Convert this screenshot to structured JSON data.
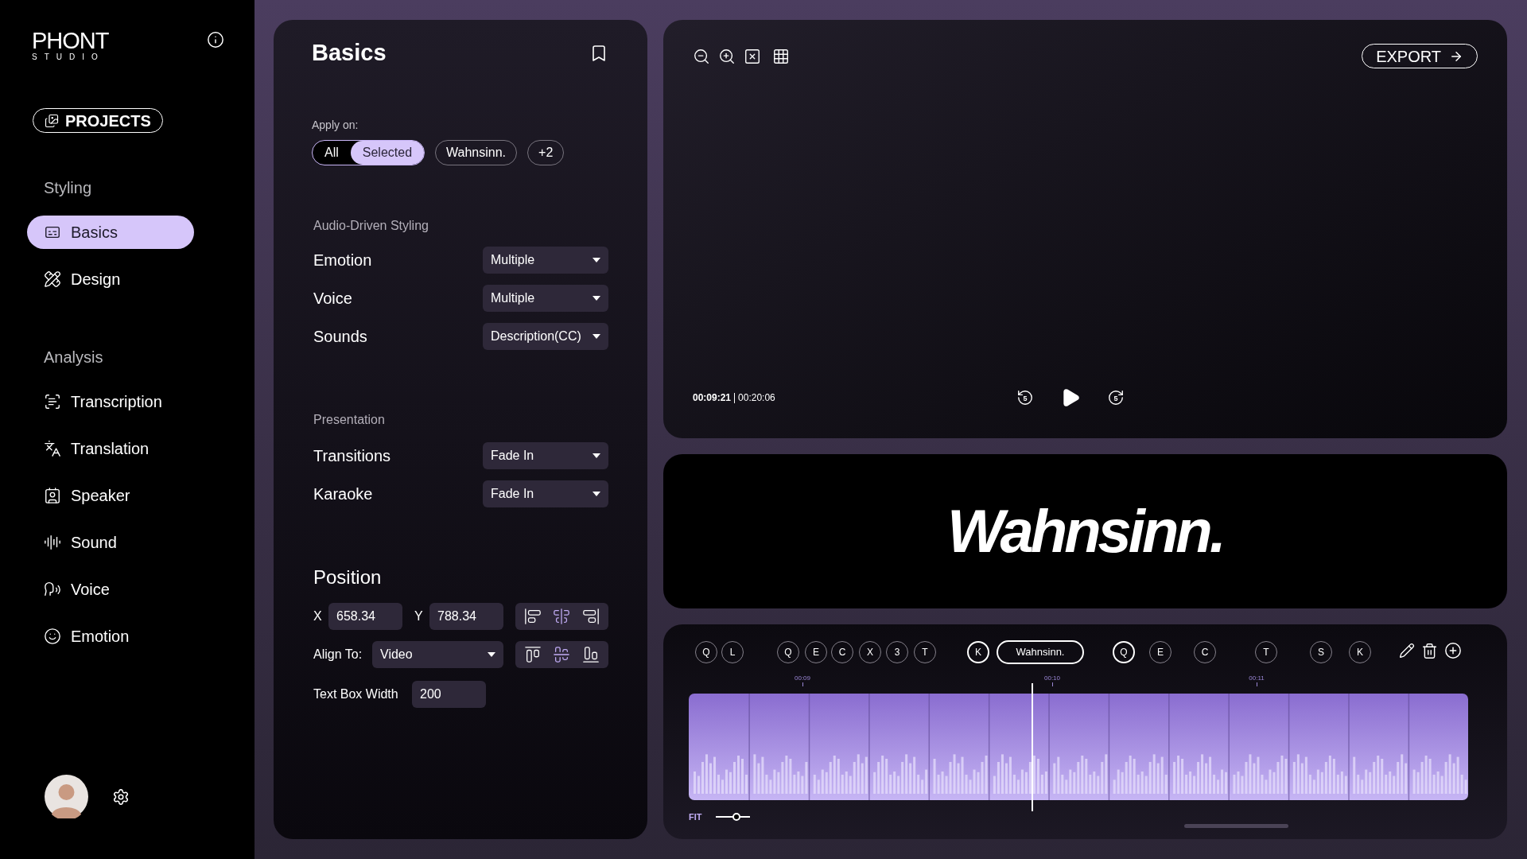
{
  "sidebar": {
    "logo": {
      "name": "PHONT",
      "sub": "STUDIO"
    },
    "projects_button": "PROJECTS",
    "sections": [
      {
        "title": "Styling",
        "items": [
          {
            "label": "Basics",
            "selected": true
          },
          {
            "label": "Design",
            "selected": false
          }
        ]
      },
      {
        "title": "Analysis",
        "items": [
          {
            "label": "Transcription",
            "selected": false
          },
          {
            "label": "Translation",
            "selected": false
          },
          {
            "label": "Speaker",
            "selected": false
          },
          {
            "label": "Sound",
            "selected": false
          },
          {
            "label": "Voice",
            "selected": false
          },
          {
            "label": "Emotion",
            "selected": false
          }
        ]
      }
    ]
  },
  "basics_panel": {
    "title": "Basics",
    "apply_on": {
      "label": "Apply on:",
      "segments": [
        {
          "label": "All",
          "selected": false
        },
        {
          "label": "Selected",
          "selected": true
        }
      ],
      "chips": [
        "Wahnsinn.",
        "+2"
      ]
    },
    "audio_styling": {
      "title": "Audio-Driven Styling",
      "rows": [
        {
          "label": "Emotion",
          "value": "Multiple"
        },
        {
          "label": "Voice",
          "value": "Multiple"
        },
        {
          "label": "Sounds",
          "value": "Description(CC)"
        }
      ]
    },
    "presentation": {
      "title": "Presentation",
      "rows": [
        {
          "label": "Transitions",
          "value": "Fade In"
        },
        {
          "label": "Karaoke",
          "value": "Fade In"
        }
      ]
    },
    "position": {
      "title": "Position",
      "x": {
        "label": "X",
        "value": "658.34"
      },
      "y": {
        "label": "Y",
        "value": "788.34"
      },
      "h_align": [
        {
          "selected": false
        },
        {
          "selected": true
        },
        {
          "selected": false
        }
      ],
      "align_to": {
        "label": "Align To:",
        "value": "Video"
      },
      "v_align": [
        {
          "selected": false
        },
        {
          "selected": true
        },
        {
          "selected": false
        }
      ],
      "text_box_width": {
        "label": "Text Box Width",
        "value": "200"
      }
    }
  },
  "preview": {
    "export": "EXPORT",
    "time_current": "00:09:21",
    "time_total": "00:20:06",
    "skip_back": "5",
    "skip_forward": "5"
  },
  "caption": {
    "text": "Wahnsinn."
  },
  "timeline": {
    "markers": [
      {
        "label": "Q",
        "kind": "marker",
        "selected": false
      },
      {
        "label": "L",
        "kind": "marker",
        "selected": false
      },
      {
        "label": "Q",
        "kind": "marker",
        "selected": false
      },
      {
        "label": "E",
        "kind": "marker",
        "selected": false
      },
      {
        "label": "C",
        "kind": "marker",
        "selected": false
      },
      {
        "label": "X",
        "kind": "marker",
        "selected": false
      },
      {
        "label": "3",
        "kind": "marker",
        "selected": false
      },
      {
        "label": "T",
        "kind": "marker",
        "selected": false
      },
      {
        "label": "K",
        "kind": "marker",
        "selected": true
      },
      {
        "label": "Wahnsinn.",
        "kind": "word",
        "selected": true
      },
      {
        "label": "Q",
        "kind": "marker",
        "selected": true
      },
      {
        "label": "E",
        "kind": "marker",
        "selected": false
      },
      {
        "label": "C",
        "kind": "marker",
        "selected": false
      },
      {
        "label": "T",
        "kind": "marker",
        "selected": false
      },
      {
        "label": "S",
        "kind": "marker",
        "selected": false
      },
      {
        "label": "K",
        "kind": "marker",
        "selected": false
      }
    ],
    "ticks": [
      "00:09",
      "00:10",
      "00:11"
    ],
    "zoom_label": "FIT",
    "zoom": {
      "level": 0.6
    }
  }
}
